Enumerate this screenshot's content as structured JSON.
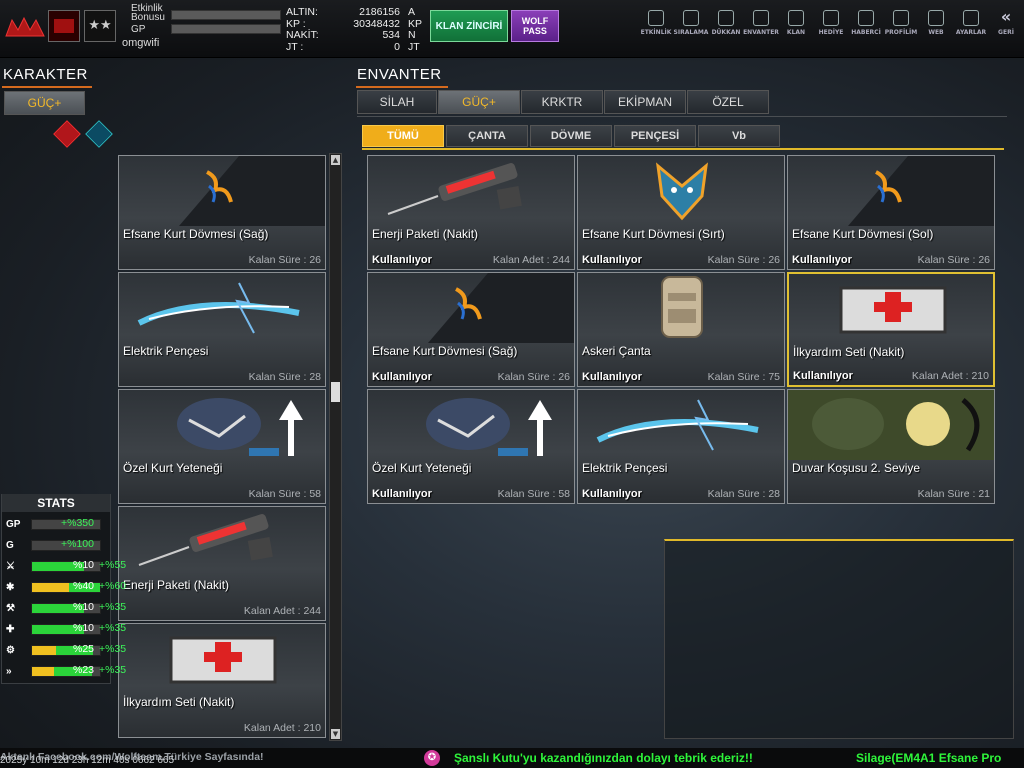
{
  "topbar": {
    "labels": {
      "event_bonus": "Etkinlik\nBonusu",
      "gp": "GP"
    },
    "username": "omgwifi",
    "currency": [
      {
        "label": "ALTIN:",
        "value": "2186156",
        "unit": "A"
      },
      {
        "label": "KP :",
        "value": "30348432",
        "unit": "KP"
      },
      {
        "label": "NAKİT:",
        "value": "534",
        "unit": "N"
      },
      {
        "label": "JT :",
        "value": "0",
        "unit": "JT"
      }
    ],
    "klan_button": "KLAN ZİNCİRİ",
    "wolf_button": "WOLF\nPASS",
    "nav": [
      {
        "label": "ETKİNLİK",
        "icon": "clock-icon"
      },
      {
        "label": "SIRALAMA",
        "icon": "medal-icon"
      },
      {
        "label": "DÜKKAN",
        "icon": "cart-icon"
      },
      {
        "label": "ENVANTER",
        "icon": "inventory-icon"
      },
      {
        "label": "KLAN",
        "icon": "shield-icon"
      },
      {
        "label": "HEDİYE",
        "icon": "gift-icon"
      },
      {
        "label": "HABERCİ",
        "icon": "megaphone-icon"
      },
      {
        "label": "PROFİLİM",
        "icon": "profile-icon"
      },
      {
        "label": "WEB",
        "icon": "globe-icon"
      },
      {
        "label": "AYARLAR",
        "icon": "gear-icon"
      },
      {
        "label": "GERİ",
        "icon": "back-icon"
      }
    ]
  },
  "left": {
    "title": "KARAKTER",
    "tab": "GÜÇ+",
    "items": [
      {
        "name": "Efsane Kurt Dövmesi (Sağ)",
        "remain": "Kalan Süre : 26",
        "art": "tattoo"
      },
      {
        "name": "Elektrik Pençesi",
        "remain": "Kalan Süre : 28",
        "art": "electric"
      },
      {
        "name": "Özel Kurt Yeteneği",
        "remain": "Kalan Süre : 58",
        "art": "wolf"
      },
      {
        "name": "Enerji Paketi (Nakit)",
        "remain": "Kalan Adet : 244",
        "art": "syringe"
      },
      {
        "name": "İlkyardım Seti (Nakit)",
        "remain": "Kalan Adet : 210",
        "art": "medkit"
      }
    ]
  },
  "stats": {
    "title": "STATS",
    "rows": [
      {
        "icon": "GP",
        "value": "+%350",
        "add": "",
        "fill": 0,
        "color": "#f0c020"
      },
      {
        "icon": "G",
        "value": "+%100",
        "add": "",
        "fill": 0,
        "color": "#f0c020"
      },
      {
        "icon": "⚔",
        "value": "%10",
        "add": "+%55",
        "fill": 0.22,
        "color": "#2bd43a"
      },
      {
        "icon": "✱",
        "value": "%40",
        "add": "+%60",
        "fill": 0.55,
        "color": "#f0c020"
      },
      {
        "icon": "⚒",
        "value": "%10",
        "add": "+%35",
        "fill": 0.22,
        "color": "#2bd43a"
      },
      {
        "icon": "✚",
        "value": "%10",
        "add": "+%35",
        "fill": 0.22,
        "color": "#2bd43a"
      },
      {
        "icon": "⚙",
        "value": "%25",
        "add": "+%35",
        "fill": 0.35,
        "color": "#f0c020"
      },
      {
        "icon": "»",
        "value": "%23",
        "add": "+%35",
        "fill": 0.33,
        "color": "#f0c020"
      }
    ]
  },
  "right": {
    "title": "ENVANTER",
    "tabs": [
      "SİLAH",
      "GÜÇ+",
      "KRKTR",
      "EKİPMAN",
      "ÖZEL"
    ],
    "active_tab": 1,
    "subtabs": [
      "TÜMÜ",
      "ÇANTA",
      "DÖVME",
      "PENÇESİ",
      "Vb"
    ],
    "active_subtab": 0,
    "items": [
      {
        "name": "Enerji Paketi (Nakit)",
        "status": "Kullanılıyor",
        "remain": "Kalan Adet : 244",
        "art": "syringe"
      },
      {
        "name": "Efsane Kurt Dövmesi (Sırt)",
        "status": "Kullanılıyor",
        "remain": "Kalan Süre : 26",
        "art": "wolfhead"
      },
      {
        "name": "Efsane Kurt Dövmesi (Sol)",
        "status": "Kullanılıyor",
        "remain": "Kalan Süre : 26",
        "art": "tattoo"
      },
      {
        "name": "Efsane Kurt Dövmesi (Sağ)",
        "status": "Kullanılıyor",
        "remain": "Kalan Süre : 26",
        "art": "tattoo"
      },
      {
        "name": "Askeri Çanta",
        "status": "Kullanılıyor",
        "remain": "Kalan Süre : 75",
        "art": "bag"
      },
      {
        "name": "İlkyardım Seti (Nakit)",
        "status": "Kullanılıyor",
        "remain": "Kalan Adet : 210",
        "art": "medkit"
      },
      {
        "name": "Özel Kurt Yeteneği",
        "status": "Kullanılıyor",
        "remain": "Kalan Süre : 58",
        "art": "wolf"
      },
      {
        "name": "Elektrik Pençesi",
        "status": "Kullanılıyor",
        "remain": "Kalan Süre : 28",
        "art": "electric"
      },
      {
        "name": "Duvar Koşusu 2. Seviye",
        "status": "",
        "remain": "Kalan Süre : 21",
        "art": "wallrun"
      }
    ]
  },
  "ticker": {
    "left": "2025y 10m 12d 23h 12m 40s 0662 665",
    "left_overlay": "Aktanlı Facebook.com/Wolfteam.Türkiye Sayfasında!",
    "middle": "Şanslı Kutu'yu kazandığınızdan dolayı tebrik ederiz!!",
    "right": "Silage(EM4A1 Efsane Pro"
  }
}
